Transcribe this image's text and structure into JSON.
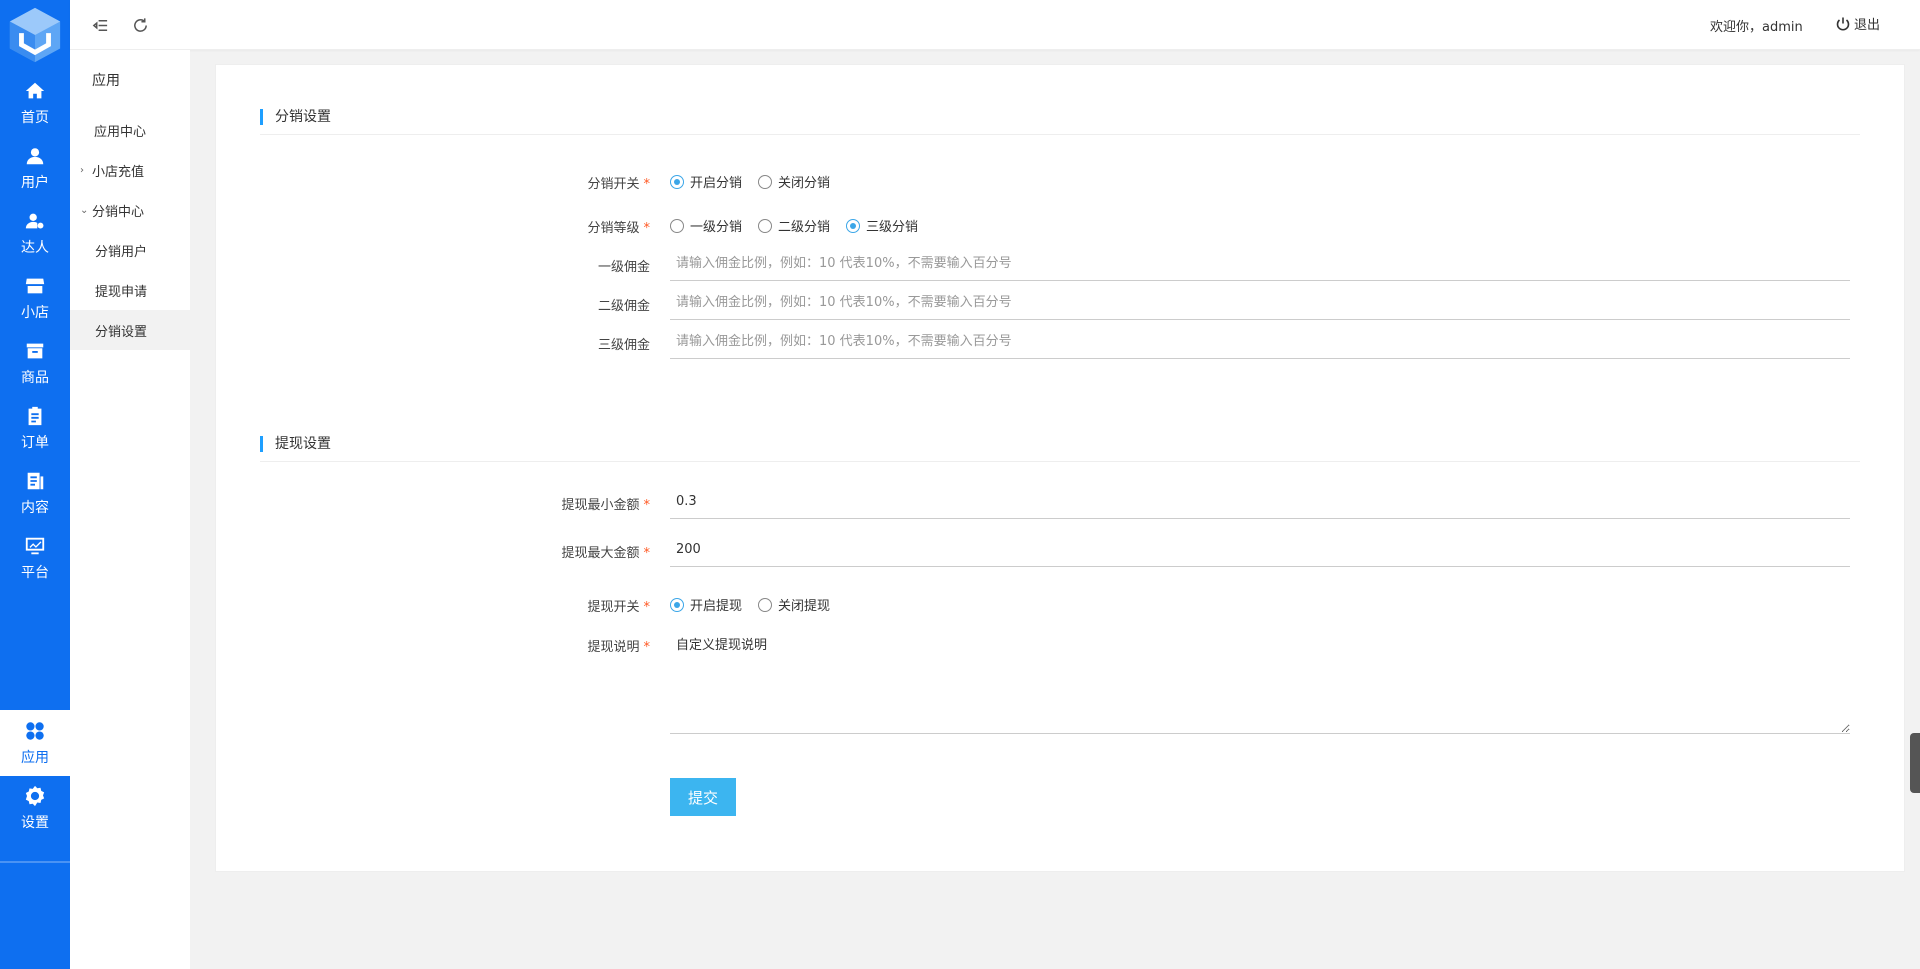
{
  "sidebar": {
    "items": [
      {
        "label": "首页",
        "icon": "home-icon"
      },
      {
        "label": "用户",
        "icon": "user-icon"
      },
      {
        "label": "达人",
        "icon": "expert-icon"
      },
      {
        "label": "小店",
        "icon": "store-icon"
      },
      {
        "label": "商品",
        "icon": "product-box-icon"
      },
      {
        "label": "订单",
        "icon": "clipboard-icon"
      },
      {
        "label": "内容",
        "icon": "document-icon"
      },
      {
        "label": "平台",
        "icon": "monitor-chart-icon"
      },
      {
        "label": "应用",
        "icon": "apps-grid-icon"
      },
      {
        "label": "设置",
        "icon": "gear-icon"
      }
    ],
    "active": "应用",
    "accent": "#0e6ff0"
  },
  "submenu": {
    "title": "应用",
    "items": [
      {
        "label": "应用中心"
      },
      {
        "label": "小店充值",
        "arrow": ">"
      },
      {
        "label": "分销中心",
        "arrow": "v"
      },
      {
        "label": "分销用户"
      },
      {
        "label": "提现申请"
      },
      {
        "label": "分销设置"
      }
    ]
  },
  "topbar": {
    "welcome": "欢迎你，admin",
    "logout_label": "退出"
  },
  "form": {
    "distribution_section": "分销设置",
    "switch_label": "分销开关",
    "switch_options": [
      "开启分销",
      "关闭分销"
    ],
    "switch_selected": "开启分销",
    "level_label": "分销等级",
    "level_options": [
      "一级分销",
      "二级分销",
      "三级分销"
    ],
    "level_selected": "三级分销",
    "commission_placeholder": "请输入佣金比例，例如：10 代表10%，不需要输入百分号",
    "commission1_label": "一级佣金",
    "commission2_label": "二级佣金",
    "commission3_label": "三级佣金",
    "withdraw_section": "提现设置",
    "min_label": "提现最小金额",
    "min_value": "0.3",
    "max_label": "提现最大金额",
    "max_value": "200",
    "withdraw_switch_label": "提现开关",
    "withdraw_options": [
      "开启提现",
      "关闭提现"
    ],
    "withdraw_selected": "开启提现",
    "desc_label": "提现说明",
    "desc_value": "自定义提现说明",
    "required_mark": "*",
    "submit_label": "提交"
  }
}
